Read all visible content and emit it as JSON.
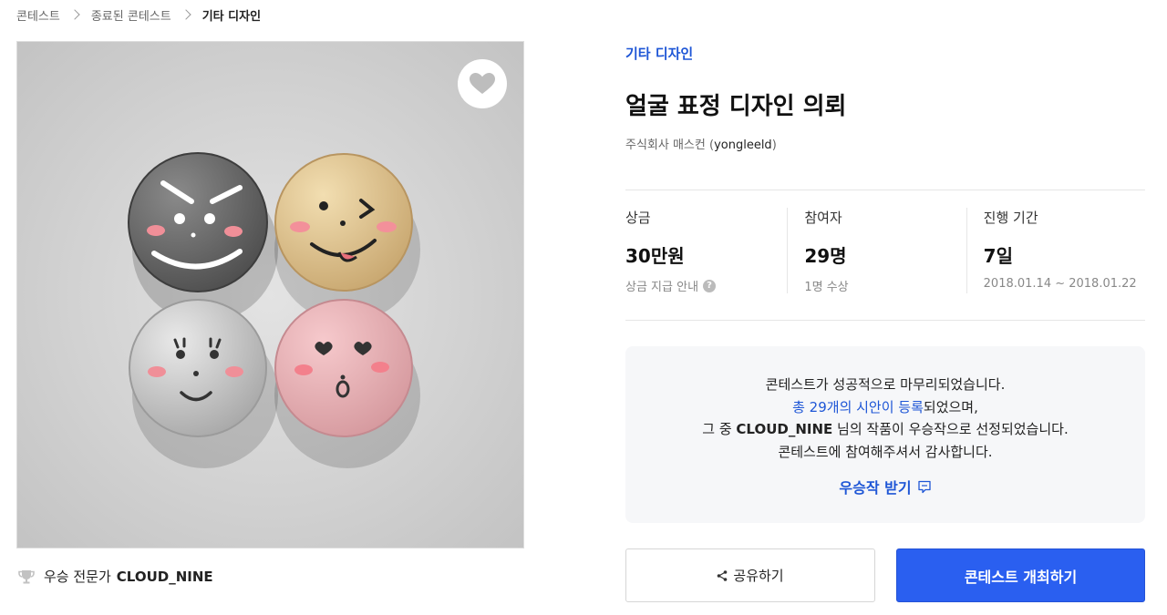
{
  "breadcrumb": {
    "items": [
      "콘테스트",
      "종료된 콘테스트",
      "기타 디자인"
    ]
  },
  "gallery": {
    "favorite_icon": "heart-icon"
  },
  "winner": {
    "icon": "trophy-icon",
    "label": "우승 전문가",
    "name": "CLOUD_NINE"
  },
  "contest": {
    "category": "기타 디자인",
    "title": "얼굴 표정 디자인 의뢰",
    "host_company": "주식회사 매스컨",
    "host_id_open": "(",
    "host_id": "yongleeld",
    "host_id_close": ")"
  },
  "stats": [
    {
      "label": "상금",
      "value": "30만원",
      "sub": "상금 지급 안내"
    },
    {
      "label": "참여자",
      "value": "29명",
      "sub": "1명 수상"
    },
    {
      "label": "진행 기간",
      "value": "7일",
      "sub": "2018.01.14 ~ 2018.01.22"
    }
  ],
  "notice": {
    "line1": "콘테스트가 성공적으로 마무리되었습니다.",
    "line2_highlight": "총 29개의 시안이 등록",
    "line2_rest": "되었으며,",
    "line3_pre": "그 중 ",
    "line3_name": "CLOUD_NINE",
    "line3_post": " 님의 작품이 우승작으로 선정되었습니다.",
    "line4": "콘테스트에 참여해주셔서 감사합니다.",
    "receive_label": "우승작 받기"
  },
  "actions": {
    "share_label": "공유하기",
    "host_label": "콘테스트 개최하기"
  },
  "colors": {
    "accent": "#1e56d6",
    "primary_button": "#2a5ff0",
    "notice_bg": "#f6f7f9"
  }
}
